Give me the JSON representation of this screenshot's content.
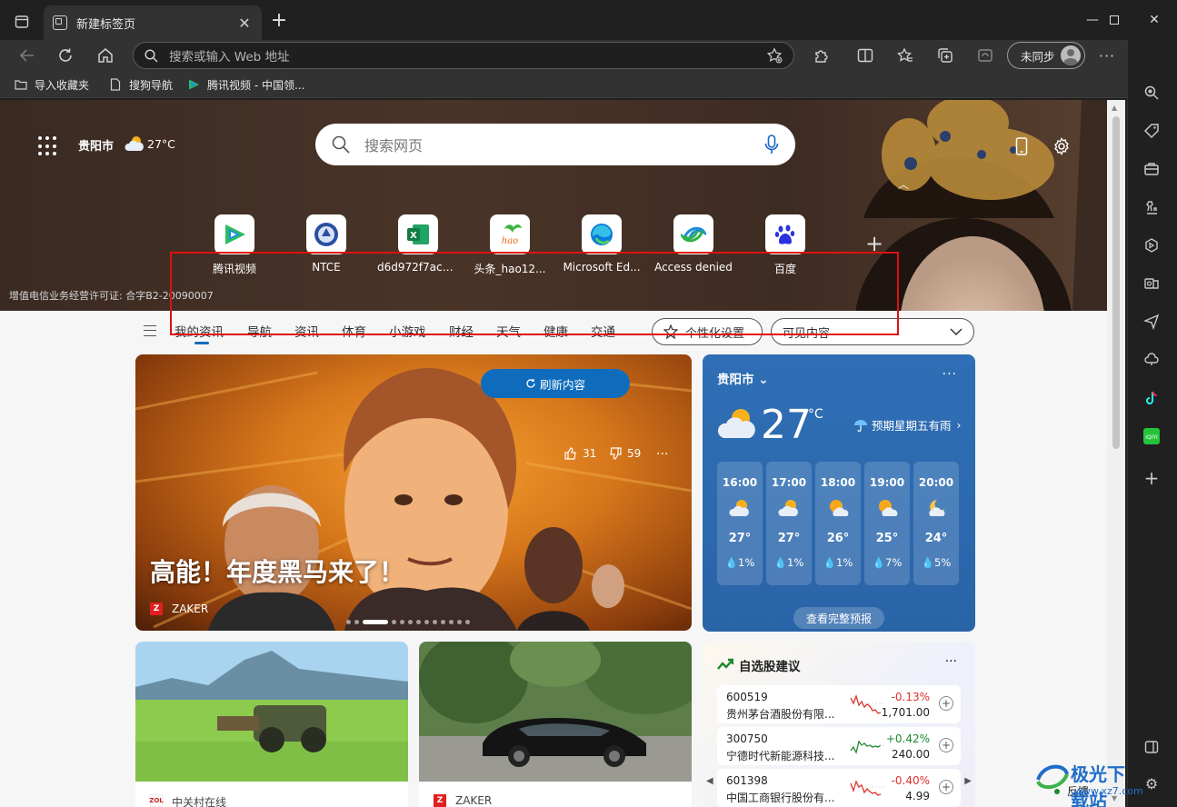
{
  "browser": {
    "tab_title": "新建标签页",
    "address_placeholder": "搜索或输入 Web 地址",
    "profile_label": "未同步",
    "favorites": [
      "导入收藏夹",
      "搜狗导航",
      "腾讯视频 - 中国领..."
    ],
    "window_controls": [
      "minimize-icon",
      "maximize-icon",
      "close-icon"
    ]
  },
  "hero": {
    "city": "贵阳市",
    "temp": "27°C",
    "search_placeholder": "搜索网页",
    "license": "增值电信业务经营许可证: 合字B2-20090007",
    "tiles": [
      "腾讯视频",
      "NTCE",
      "d6d972f7acd...",
      "头条_hao12...",
      "Microsoft Ed...",
      "Access denied",
      "百度"
    ]
  },
  "feed_nav": {
    "items": [
      "我的资讯",
      "导航",
      "资讯",
      "体育",
      "小游戏",
      "财经",
      "天气",
      "健康",
      "交通"
    ],
    "personalize": "个性化设置",
    "visible_content": "可见内容"
  },
  "main_news": {
    "refresh": "刷新内容",
    "title": "高能！年度黑马来了！",
    "source": "ZAKER",
    "likes": "31",
    "dislikes": "59"
  },
  "weather": {
    "city": "贵阳市",
    "temp": "27",
    "unit": "°C",
    "forecast": "预期星期五有雨",
    "hours": [
      {
        "time": "16:00",
        "temp": "27°",
        "precip": "1%"
      },
      {
        "time": "17:00",
        "temp": "27°",
        "precip": "1%"
      },
      {
        "time": "18:00",
        "temp": "26°",
        "precip": "1%"
      },
      {
        "time": "19:00",
        "temp": "25°",
        "precip": "7%"
      },
      {
        "time": "20:00",
        "temp": "24°",
        "precip": "5%"
      }
    ],
    "full_forecast": "查看完整预报"
  },
  "cards": [
    {
      "source": "中关村在线"
    },
    {
      "source": "ZAKER"
    }
  ],
  "stocks": {
    "title": "自选股建议",
    "items": [
      {
        "code": "600519",
        "name": "贵州茅台酒股份有限...",
        "change": "-0.13%",
        "price": "1,701.00",
        "color": "#e0302a"
      },
      {
        "code": "300750",
        "name": "宁德时代新能源科技...",
        "change": "+0.42%",
        "price": "240.00",
        "color": "#1a8a2c"
      },
      {
        "code": "601398",
        "name": "中国工商银行股份有...",
        "change": "-0.40%",
        "price": "4.99",
        "color": "#e0302a"
      }
    ]
  },
  "feedback": "反馈",
  "watermark": {
    "brand": "极光下载站",
    "site": "www.xz7.com"
  },
  "colors": {
    "accent": "#0f6cbd",
    "highlight_box": "#e01010"
  }
}
